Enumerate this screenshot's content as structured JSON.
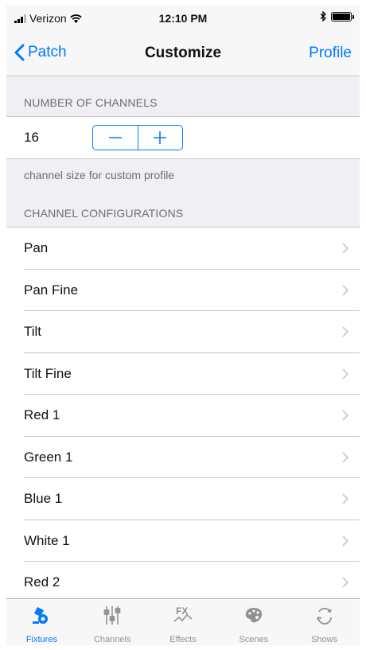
{
  "status_bar": {
    "carrier": "Verizon",
    "time": "12:10 PM",
    "bluetooth_icon": "bluetooth-icon",
    "battery_level": 1.0
  },
  "nav": {
    "back_label": "Patch",
    "title": "Customize",
    "right_label": "Profile"
  },
  "channels_section": {
    "header": "NUMBER OF CHANNELS",
    "value": "16",
    "decrement_icon": "minus-icon",
    "increment_icon": "plus-icon",
    "footer": "channel size for custom profile"
  },
  "config_section": {
    "header": "CHANNEL CONFIGURATIONS",
    "items": [
      {
        "label": "Pan"
      },
      {
        "label": "Pan Fine"
      },
      {
        "label": "Tilt"
      },
      {
        "label": "Tilt Fine"
      },
      {
        "label": "Red 1"
      },
      {
        "label": "Green 1"
      },
      {
        "label": "Blue 1"
      },
      {
        "label": "White 1"
      },
      {
        "label": "Red 2"
      }
    ]
  },
  "tab_bar": {
    "active_color": "#007aff",
    "inactive_color": "#929292",
    "tabs": [
      {
        "label": "Fixtures",
        "icon": "fixtures-icon",
        "active": true
      },
      {
        "label": "Channels",
        "icon": "sliders-icon",
        "active": false
      },
      {
        "label": "Effects",
        "icon": "fx-icon",
        "active": false
      },
      {
        "label": "Scenes",
        "icon": "palette-icon",
        "active": false
      },
      {
        "label": "Shows",
        "icon": "cycle-icon",
        "active": false
      }
    ]
  }
}
